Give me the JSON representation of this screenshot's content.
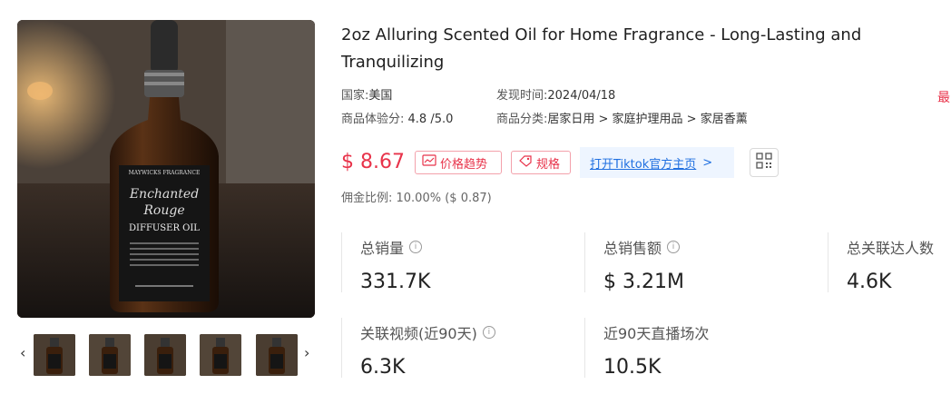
{
  "product": {
    "title": "2oz Alluring Scented Oil for Home Fragrance - Long-Lasting and Tranquilizing",
    "label_text": {
      "brand": "MAYWICKS FRAGRANCE",
      "name_line1": "Enchanted",
      "name_line2": "Rouge",
      "type": "DIFFUSER OIL"
    }
  },
  "meta": {
    "country_label": "国家:",
    "country_value": "美国",
    "found_label": "发现时间:",
    "found_value": "2024/04/18",
    "exp_label": "商品体验分:",
    "exp_value": "4.8 /5.0",
    "category_label": "商品分类:",
    "category_value": "居家日用 > 家庭护理用品 > 家居香薰",
    "truncated_badge": "最"
  },
  "price": "$ 8.67",
  "buttons": {
    "trend": "价格趋势",
    "spec": "规格",
    "tiktok": "打开Tiktok官方主页",
    "tiktok_arrow": ">"
  },
  "commission": "佣金比例: 10.00% ($ 0.87)",
  "stats": {
    "total_sales_label": "总销量",
    "total_sales_value": "331.7K",
    "total_revenue_label": "总销售额",
    "total_revenue_value": "$ 3.21M",
    "total_creators_label": "总关联达人数",
    "total_creators_value": "4.6K",
    "videos_label": "关联视频(近90天)",
    "videos_value": "6.3K",
    "live_label": "近90天直播场次",
    "live_value": "10.5K"
  },
  "gallery": {
    "prev": "‹",
    "next": "›"
  },
  "colors": {
    "accent_red": "#e8334a",
    "link_blue": "#1f6fe0",
    "link_bg": "#eef5ff"
  }
}
